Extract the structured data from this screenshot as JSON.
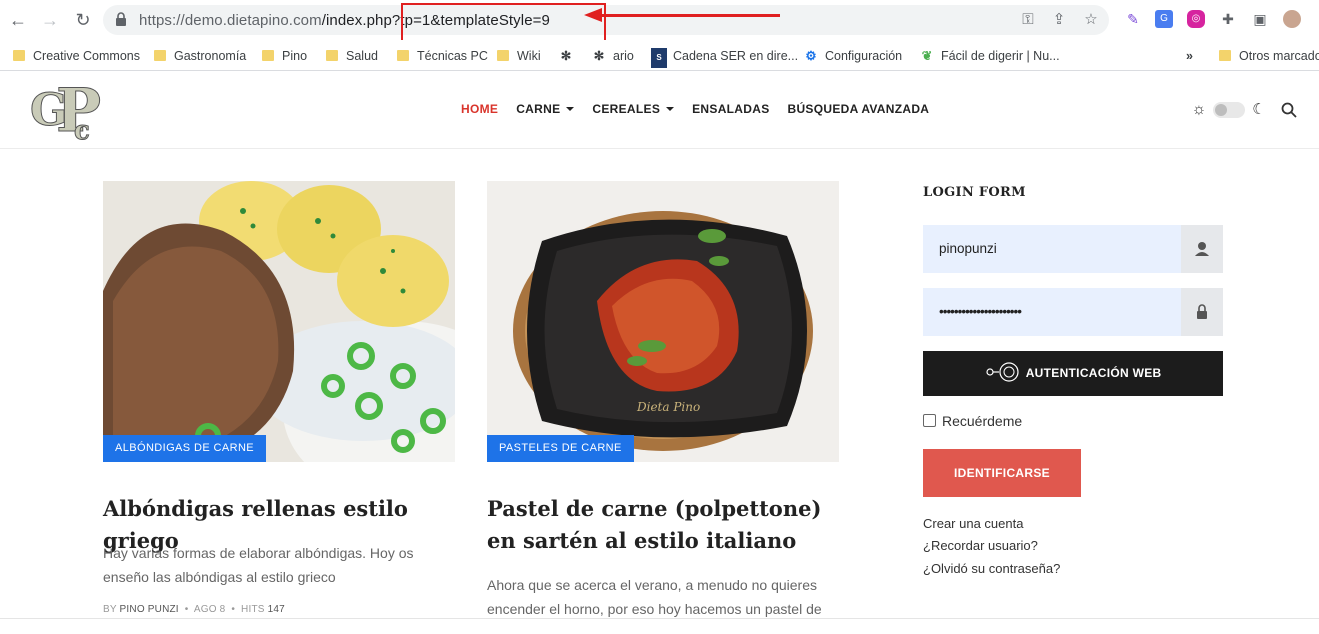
{
  "browser": {
    "url_host": "https://demo.dietapino.com",
    "url_path": "/index.php?tp=1&templateStyle=9",
    "bookmarks": [
      {
        "label": "Creative Commons",
        "icon": "folder-icon"
      },
      {
        "label": "Gastronomía",
        "icon": "folder-icon"
      },
      {
        "label": "Pino",
        "icon": "folder-icon"
      },
      {
        "label": "Salud",
        "icon": "folder-icon"
      },
      {
        "label": "Técnicas PC",
        "icon": "folder-icon"
      },
      {
        "label": "Wiki",
        "icon": "folder-icon"
      },
      {
        "label": "",
        "icon": "joomla-icon"
      },
      {
        "label": "ario",
        "icon": "joomla-icon"
      },
      {
        "label": "Cadena SER en dire...",
        "icon": "ser-icon"
      },
      {
        "label": "Configuración",
        "icon": "gear-icon"
      },
      {
        "label": "Fácil de digerir | Nu...",
        "icon": "leaf-icon"
      },
      {
        "label": "»",
        "icon": "more-icon"
      },
      {
        "label": "Otros marcado",
        "icon": "folder-icon"
      }
    ]
  },
  "site": {
    "logo_text": "GPc",
    "menu": [
      {
        "label": "HOME",
        "active": true,
        "dropdown": false
      },
      {
        "label": "CARNE",
        "active": false,
        "dropdown": true
      },
      {
        "label": "CEREALES",
        "active": false,
        "dropdown": true
      },
      {
        "label": "ENSALADAS",
        "active": false,
        "dropdown": false
      },
      {
        "label": "BÚSQUEDA AVANZADA",
        "active": false,
        "dropdown": false
      }
    ]
  },
  "articles": [
    {
      "category": "ALBÓNDIGAS DE CARNE",
      "title": "Albóndigas rellenas estilo griego",
      "excerpt": "Hay varias formas de elaborar albóndigas. Hoy os enseño las albóndigas al estilo grieco",
      "meta_by": "BY",
      "author": "PINO PUNZI",
      "ago": "AGO 8",
      "hits_label": "HITS",
      "hits": "147"
    },
    {
      "category": "PASTELES DE CARNE",
      "title": "Pastel de carne (polpettone) en sartén al estilo italiano",
      "excerpt": "Ahora que se acerca el verano, a menudo no quieres encender el horno, por eso hoy hacemos un pastel de",
      "watermark": "Dieta Pino"
    }
  ],
  "login": {
    "title": "LOGIN FORM",
    "username": "pinopunzi",
    "password": "••••••••••••••••••••••",
    "web_auth_label": "AUTENTICACIÓN WEB",
    "remember_label": "Recuérdeme",
    "submit_label": "IDENTIFICARSE",
    "links": [
      "Crear una cuenta",
      "¿Recordar usuario?",
      "¿Olvidó su contraseña?"
    ]
  },
  "colors": {
    "accent_red": "#d9342b",
    "badge_blue": "#1e73e8",
    "login_button": "#e0584e",
    "annotation_red": "#e02020"
  }
}
